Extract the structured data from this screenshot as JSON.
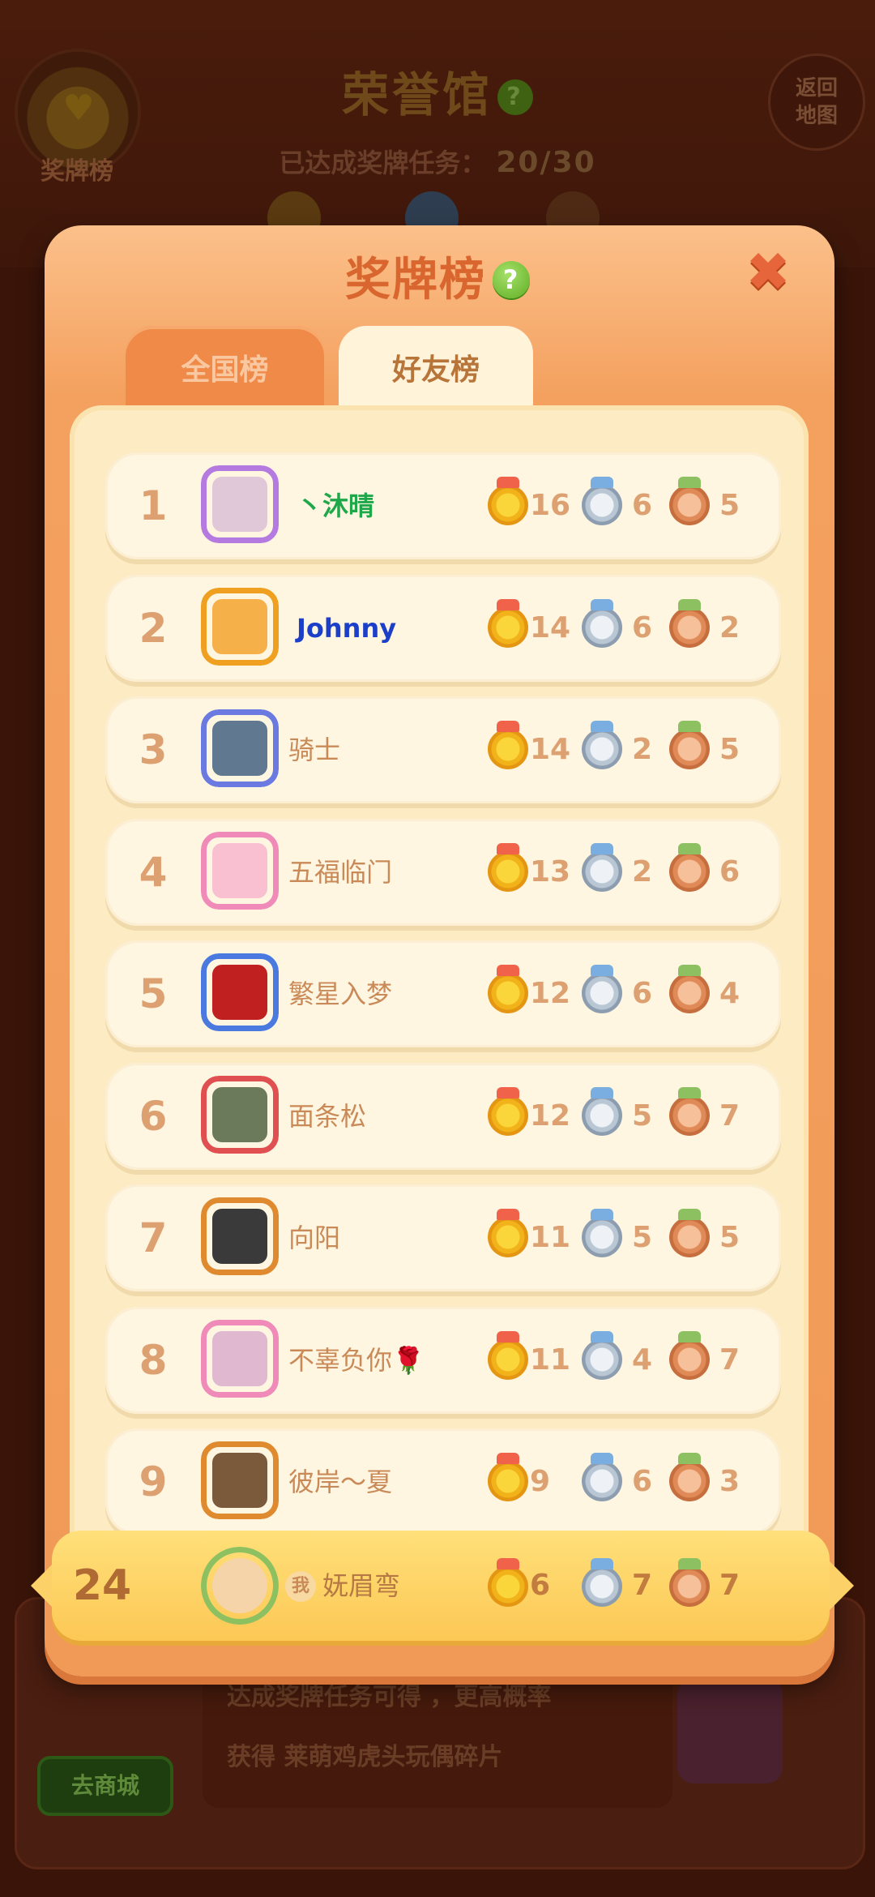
{
  "background": {
    "hall_title": "荣誉馆",
    "help_glyph": "?",
    "badge_label": "奖牌榜",
    "back_button": "返回地图",
    "progress_label": "已达成奖牌任务：",
    "progress_value": "20/30",
    "shop_button": "去商城",
    "info_line_1": "达成奖牌任务可得 ，更高概率",
    "info_line_2": "获得 莱萌鸡虎头玩偶碎片"
  },
  "modal": {
    "title": "奖牌榜",
    "help_glyph": "?",
    "close_glyph": "✖",
    "tabs": [
      {
        "label": "全国榜",
        "active": false
      },
      {
        "label": "好友榜",
        "active": true
      }
    ]
  },
  "colors": {
    "gold": "#f1b21a",
    "silver": "#b9c6d4",
    "bronze": "#e08a58",
    "count_text": "#dca071",
    "name_text": "#c98a58",
    "vip_green": "#1fa84a",
    "vip_blue": "#1b3fc8"
  },
  "leaderboard": [
    {
      "rank": "1",
      "name": "丶沐晴",
      "gold": "16",
      "silver": "6",
      "bronze": "5",
      "name_style": "vip-green"
    },
    {
      "rank": "2",
      "name": "Johnny",
      "gold": "14",
      "silver": "6",
      "bronze": "2",
      "name_style": "vip-blue"
    },
    {
      "rank": "3",
      "name": "骑士",
      "gold": "14",
      "silver": "2",
      "bronze": "5",
      "name_style": "normal"
    },
    {
      "rank": "4",
      "name": "五福临门",
      "gold": "13",
      "silver": "2",
      "bronze": "6",
      "name_style": "normal"
    },
    {
      "rank": "5",
      "name": "繁星入梦",
      "gold": "12",
      "silver": "6",
      "bronze": "4",
      "name_style": "normal"
    },
    {
      "rank": "6",
      "name": "面条松",
      "gold": "12",
      "silver": "5",
      "bronze": "7",
      "name_style": "normal"
    },
    {
      "rank": "7",
      "name": "向阳",
      "gold": "11",
      "silver": "5",
      "bronze": "5",
      "name_style": "normal"
    },
    {
      "rank": "8",
      "name": "不辜负你🌹",
      "gold": "11",
      "silver": "4",
      "bronze": "7",
      "name_style": "normal"
    },
    {
      "rank": "9",
      "name": "彼岸～夏",
      "gold": "9",
      "silver": "6",
      "bronze": "3",
      "name_style": "normal"
    }
  ],
  "self": {
    "rank": "24",
    "me_tag": "我",
    "name": "妩眉弯",
    "gold": "6",
    "silver": "7",
    "bronze": "7"
  },
  "icons": {
    "medal_gold": "gold-medal-icon",
    "medal_silver": "silver-medal-icon",
    "medal_bronze": "bronze-medal-icon"
  }
}
